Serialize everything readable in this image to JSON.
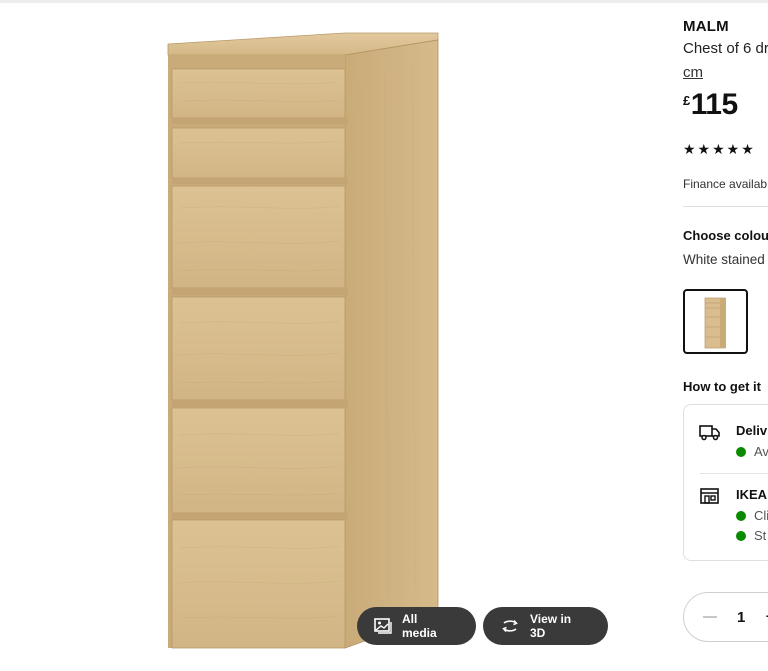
{
  "product": {
    "name": "MALM",
    "description": "Chest of 6 dr",
    "unit": "cm",
    "price_currency": "£",
    "price_value": "115",
    "rating_stars": "★★★★★",
    "finance_text": "Finance availab"
  },
  "gallery": {
    "all_media_label": "All media",
    "view_3d_label": "View in 3D"
  },
  "colour": {
    "heading": "Choose colou",
    "selected": "White stained"
  },
  "fulfilment": {
    "heading": "How to get it",
    "delivery_title": "Deliv",
    "delivery_status": "Av",
    "store_title": "IKEA",
    "store_status_1": "Cli",
    "store_status_2": "St"
  },
  "quantity": {
    "value": "1",
    "plus": "+"
  },
  "colors": {
    "wood": "#d9bd8f",
    "wood_dark": "#b99a69",
    "status_green": "#0a8a00",
    "button_bg": "#3a3a3a"
  },
  "icons": {
    "all_media": "image-gallery-icon",
    "view_3d": "rotate-3d-icon",
    "delivery": "delivery-truck-icon",
    "store": "store-icon"
  }
}
